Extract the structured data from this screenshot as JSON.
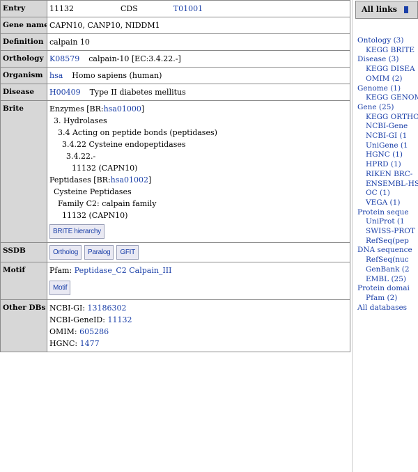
{
  "entry": {
    "label": "Entry",
    "id": "11132",
    "type": "CDS",
    "genome_id": "T01001"
  },
  "gene_name": {
    "label": "Gene name",
    "value": "CAPN10, CANP10, NIDDM1"
  },
  "definition": {
    "label": "Definition",
    "value": "calpain 10"
  },
  "orthology": {
    "label": "Orthology",
    "ko": "K08579",
    "text": "calpain-10 [EC:3.4.22.-]"
  },
  "organism": {
    "label": "Organism",
    "code": "hsa",
    "text": "Homo sapiens (human)"
  },
  "disease": {
    "label": "Disease",
    "code": "H00409",
    "text": "Type II diabetes mellitus"
  },
  "brite": {
    "label": "Brite",
    "enzymes_prefix": "Enzymes [BR:",
    "enzymes_code": "hsa01000",
    "enzymes_suffix": "]",
    "lines": [
      "3. Hydrolases",
      "3.4  Acting on peptide bonds (peptidases)",
      "3.4.22  Cysteine endopeptidases",
      "3.4.22.-",
      "11132 (CAPN10)"
    ],
    "peptidases_prefix": "Peptidases [BR:",
    "peptidases_code": "hsa01002",
    "peptidases_suffix": "]",
    "lines2": [
      "Cysteine Peptidases",
      "Family C2: calpain family",
      "11132 (CAPN10)"
    ],
    "button": "BRITE hierarchy"
  },
  "ssdb": {
    "label": "SSDB",
    "buttons": [
      "Ortholog",
      "Paralog",
      "GFIT"
    ]
  },
  "motif": {
    "label": "Motif",
    "prefix": "Pfam:",
    "domains": "Peptidase_C2 Calpain_III",
    "button": "Motif"
  },
  "other_dbs": {
    "label": "Other DBs",
    "rows": [
      {
        "key": "NCBI-GI:",
        "value": "13186302"
      },
      {
        "key": "NCBI-GeneID:",
        "value": "11132"
      },
      {
        "key": "OMIM:",
        "value": "605286"
      },
      {
        "key": "HGNC:",
        "value": "1477"
      }
    ]
  },
  "sidebar": {
    "title": "All links",
    "items": [
      {
        "text": "Ontology (3)",
        "level": 0
      },
      {
        "text": "KEGG BRITE",
        "level": 1
      },
      {
        "text": "Disease (3)",
        "level": 0
      },
      {
        "text": "KEGG DISEA",
        "level": 1
      },
      {
        "text": "OMIM (2)",
        "level": 1
      },
      {
        "text": "Genome (1)",
        "level": 0
      },
      {
        "text": "KEGG GENOM",
        "level": 1
      },
      {
        "text": "Gene (25)",
        "level": 0
      },
      {
        "text": "KEGG ORTHO",
        "level": 1
      },
      {
        "text": "NCBI-Gene",
        "level": 1
      },
      {
        "text": "NCBI-GI (1",
        "level": 1
      },
      {
        "text": "UniGene (1",
        "level": 1
      },
      {
        "text": "HGNC (1)",
        "level": 1
      },
      {
        "text": "HPRD (1)",
        "level": 1
      },
      {
        "text": "RIKEN BRC-",
        "level": 1
      },
      {
        "text": "ENSEMBL-HS",
        "level": 1
      },
      {
        "text": "OC (1)",
        "level": 1
      },
      {
        "text": "VEGA (1)",
        "level": 1
      },
      {
        "text": "Protein seque",
        "level": 0
      },
      {
        "text": "UniProt (1",
        "level": 1
      },
      {
        "text": "SWISS-PROT",
        "level": 1
      },
      {
        "text": "RefSeq(pep",
        "level": 1
      },
      {
        "text": "DNA sequence",
        "level": 0
      },
      {
        "text": "RefSeq(nuc",
        "level": 1
      },
      {
        "text": "GenBank (2",
        "level": 1
      },
      {
        "text": "EMBL (25)",
        "level": 1
      },
      {
        "text": "Protein domai",
        "level": 0
      },
      {
        "text": "Pfam (2)",
        "level": 1
      },
      {
        "text": "All databases",
        "level": 0
      }
    ]
  }
}
